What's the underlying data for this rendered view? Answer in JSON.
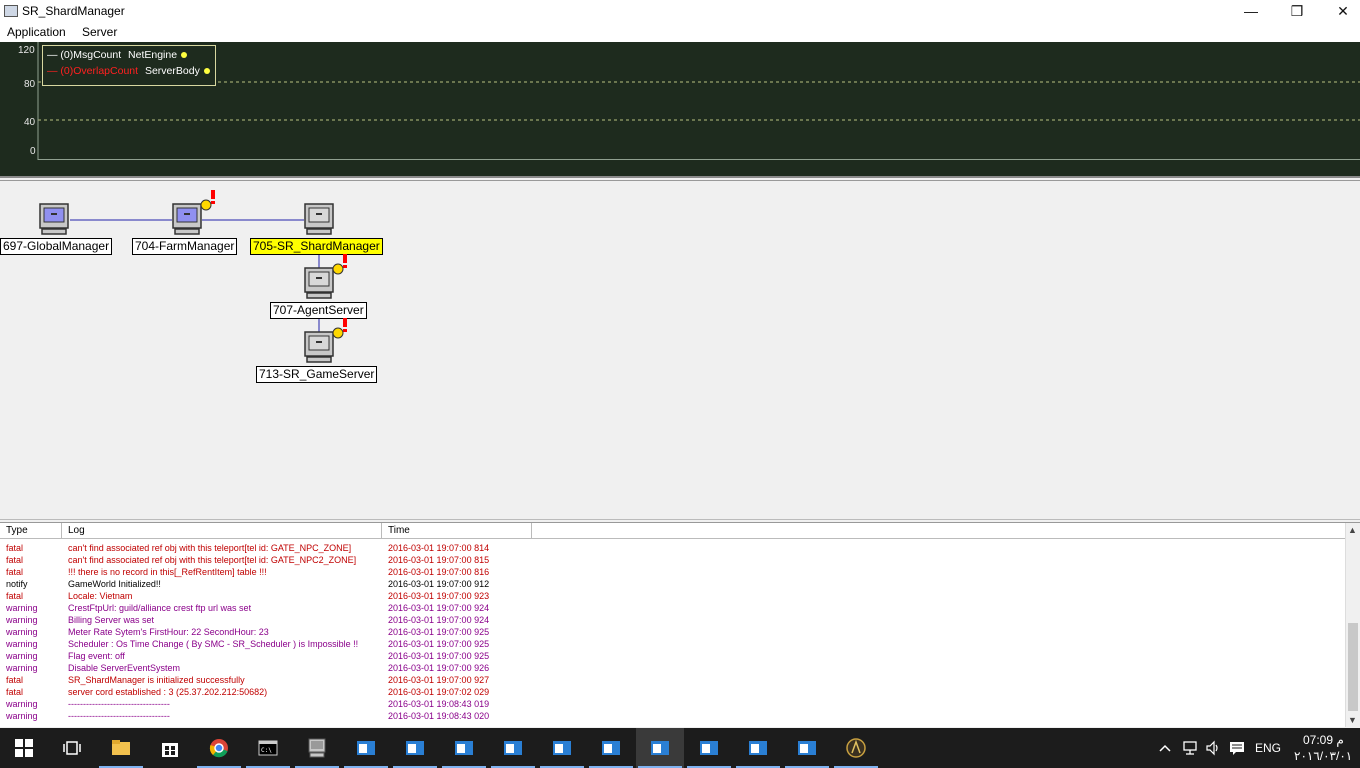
{
  "window": {
    "title": "SR_ShardManager",
    "minimize": "—",
    "restore": "❒",
    "close": "✕"
  },
  "menu": {
    "items": [
      "Application",
      "Server"
    ]
  },
  "graph": {
    "y_labels": [
      "120",
      "80",
      "40",
      "0"
    ],
    "legend": [
      {
        "prefix": "— (0)MsgCount",
        "name": "NetEngine",
        "color": "#ffffff"
      },
      {
        "prefix": "— (0)OverlapCount",
        "name": "ServerBody",
        "color": "#ff2020"
      }
    ]
  },
  "topology": {
    "nodes": [
      {
        "label": "697-GlobalManager",
        "warning": false,
        "selected": false
      },
      {
        "label": "704-FarmManager",
        "warning": true,
        "selected": false
      },
      {
        "label": "705-SR_ShardManager",
        "warning": false,
        "selected": true
      },
      {
        "label": "707-AgentServer",
        "warning": true,
        "selected": false
      },
      {
        "label": "713-SR_GameServer",
        "warning": true,
        "selected": false
      }
    ]
  },
  "log": {
    "headers": [
      "Type",
      "Log",
      "Time"
    ],
    "rows": [
      {
        "type": "fatal",
        "log": "can't find associated ref obj with this teleport[tel id: GATE_NPC_ZONE]",
        "time": "2016-03-01 19:07:00 814"
      },
      {
        "type": "fatal",
        "log": "can't find associated ref obj with this teleport[tel id: GATE_NPC2_ZONE]",
        "time": "2016-03-01 19:07:00 815"
      },
      {
        "type": "fatal",
        "log": "!!! there is no record in this[_RefRentItem] table !!!",
        "time": "2016-03-01 19:07:00 816"
      },
      {
        "type": "notify",
        "log": "GameWorld Initialized!!",
        "time": "2016-03-01 19:07:00 912"
      },
      {
        "type": "fatal",
        "log": "Locale: Vietnam",
        "time": "2016-03-01 19:07:00 923"
      },
      {
        "type": "warning",
        "log": "CrestFtpUrl: guild/alliance crest ftp url was set",
        "time": "2016-03-01 19:07:00 924"
      },
      {
        "type": "warning",
        "log": "Billing Server was set",
        "time": "2016-03-01 19:07:00 924"
      },
      {
        "type": "warning",
        "log": "Meter Rate Sytem's FirstHour: 22 SecondHour: 23",
        "time": "2016-03-01 19:07:00 925"
      },
      {
        "type": "warning",
        "log": "Scheduler : Os Time Change ( By SMC - SR_Scheduler ) is Impossible !!",
        "time": "2016-03-01 19:07:00 925"
      },
      {
        "type": "warning",
        "log": "Flag event: off",
        "time": "2016-03-01 19:07:00 925"
      },
      {
        "type": "warning",
        "log": "Disable ServerEventSystem",
        "time": "2016-03-01 19:07:00 926"
      },
      {
        "type": "fatal",
        "log": "SR_ShardManager is initialized successfully",
        "time": "2016-03-01 19:07:00 927"
      },
      {
        "type": "fatal",
        "log": "server cord established : 3 (25.37.202.212:50682)",
        "time": "2016-03-01 19:07:02 029"
      },
      {
        "type": "warning",
        "log": "----------------------------------",
        "time": "2016-03-01 19:08:43 019"
      },
      {
        "type": "warning",
        "log": "----------------------------------",
        "time": "2016-03-01 19:08:43 020"
      }
    ]
  },
  "taskbar": {
    "icons": [
      "windows-start-icon",
      "task-view-icon",
      "file-explorer-icon",
      "store-icon",
      "chrome-icon",
      "cmd-icon",
      "server-app-icon",
      "window-icon",
      "window-icon",
      "window-icon",
      "window-icon",
      "window-icon",
      "window-icon",
      "window-icon",
      "window-icon",
      "window-icon",
      "window-icon",
      "game-icon"
    ],
    "tray": {
      "language": "ENG",
      "time": "07:09 م",
      "date": "٢٠١٦/٠٣/٠١"
    }
  },
  "colors": {
    "graph_bg": "#1e2b1e",
    "selected_node": "#ffff00",
    "fatal": "#c00000",
    "warning": "#8a008a",
    "taskbar_bg": "#1c1c1c",
    "link_line": "#2222aa"
  }
}
